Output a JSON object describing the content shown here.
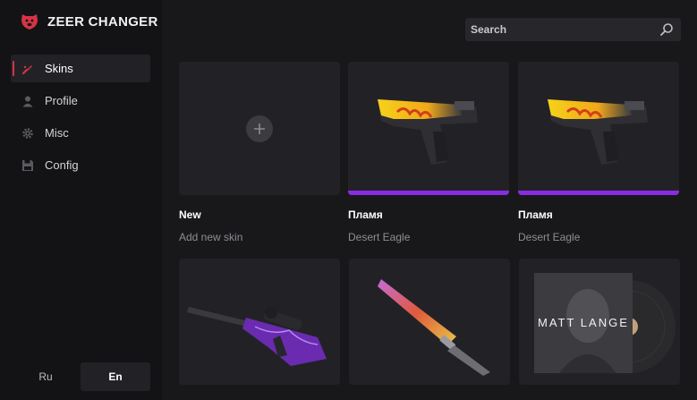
{
  "app": {
    "title": "ZEER CHANGER"
  },
  "sidebar": {
    "items": [
      {
        "label": "Skins",
        "icon": "brush-icon",
        "active": true
      },
      {
        "label": "Profile",
        "icon": "user-icon",
        "active": false
      },
      {
        "label": "Misc",
        "icon": "gear-icon",
        "active": false
      },
      {
        "label": "Config",
        "icon": "save-icon",
        "active": false
      }
    ],
    "languages": [
      {
        "label": "Ru",
        "active": false
      },
      {
        "label": "En",
        "active": true
      }
    ]
  },
  "search": {
    "placeholder": "Search",
    "value": ""
  },
  "cards": [
    {
      "name": "New",
      "subtitle": "Add new skin",
      "icon": "plus-icon"
    },
    {
      "name": "Пламя",
      "subtitle": "Desert Eagle",
      "image": "desert-eagle-blaze",
      "rarity_color": "#8a2be2"
    },
    {
      "name": "Пламя",
      "subtitle": "Desert Eagle",
      "image": "desert-eagle-blaze",
      "rarity_color": "#8a2be2"
    },
    {
      "name": "",
      "subtitle": "",
      "image": "awp-purple"
    },
    {
      "name": "",
      "subtitle": "",
      "image": "bayonet-fade"
    },
    {
      "name": "",
      "subtitle": "",
      "image": "music-kit",
      "image_text": "MATT LANGE"
    }
  ],
  "colors": {
    "accent": "#d63346",
    "rarity_purple": "#8a2be2",
    "background": "#18181b",
    "sidebar": "#131315"
  }
}
